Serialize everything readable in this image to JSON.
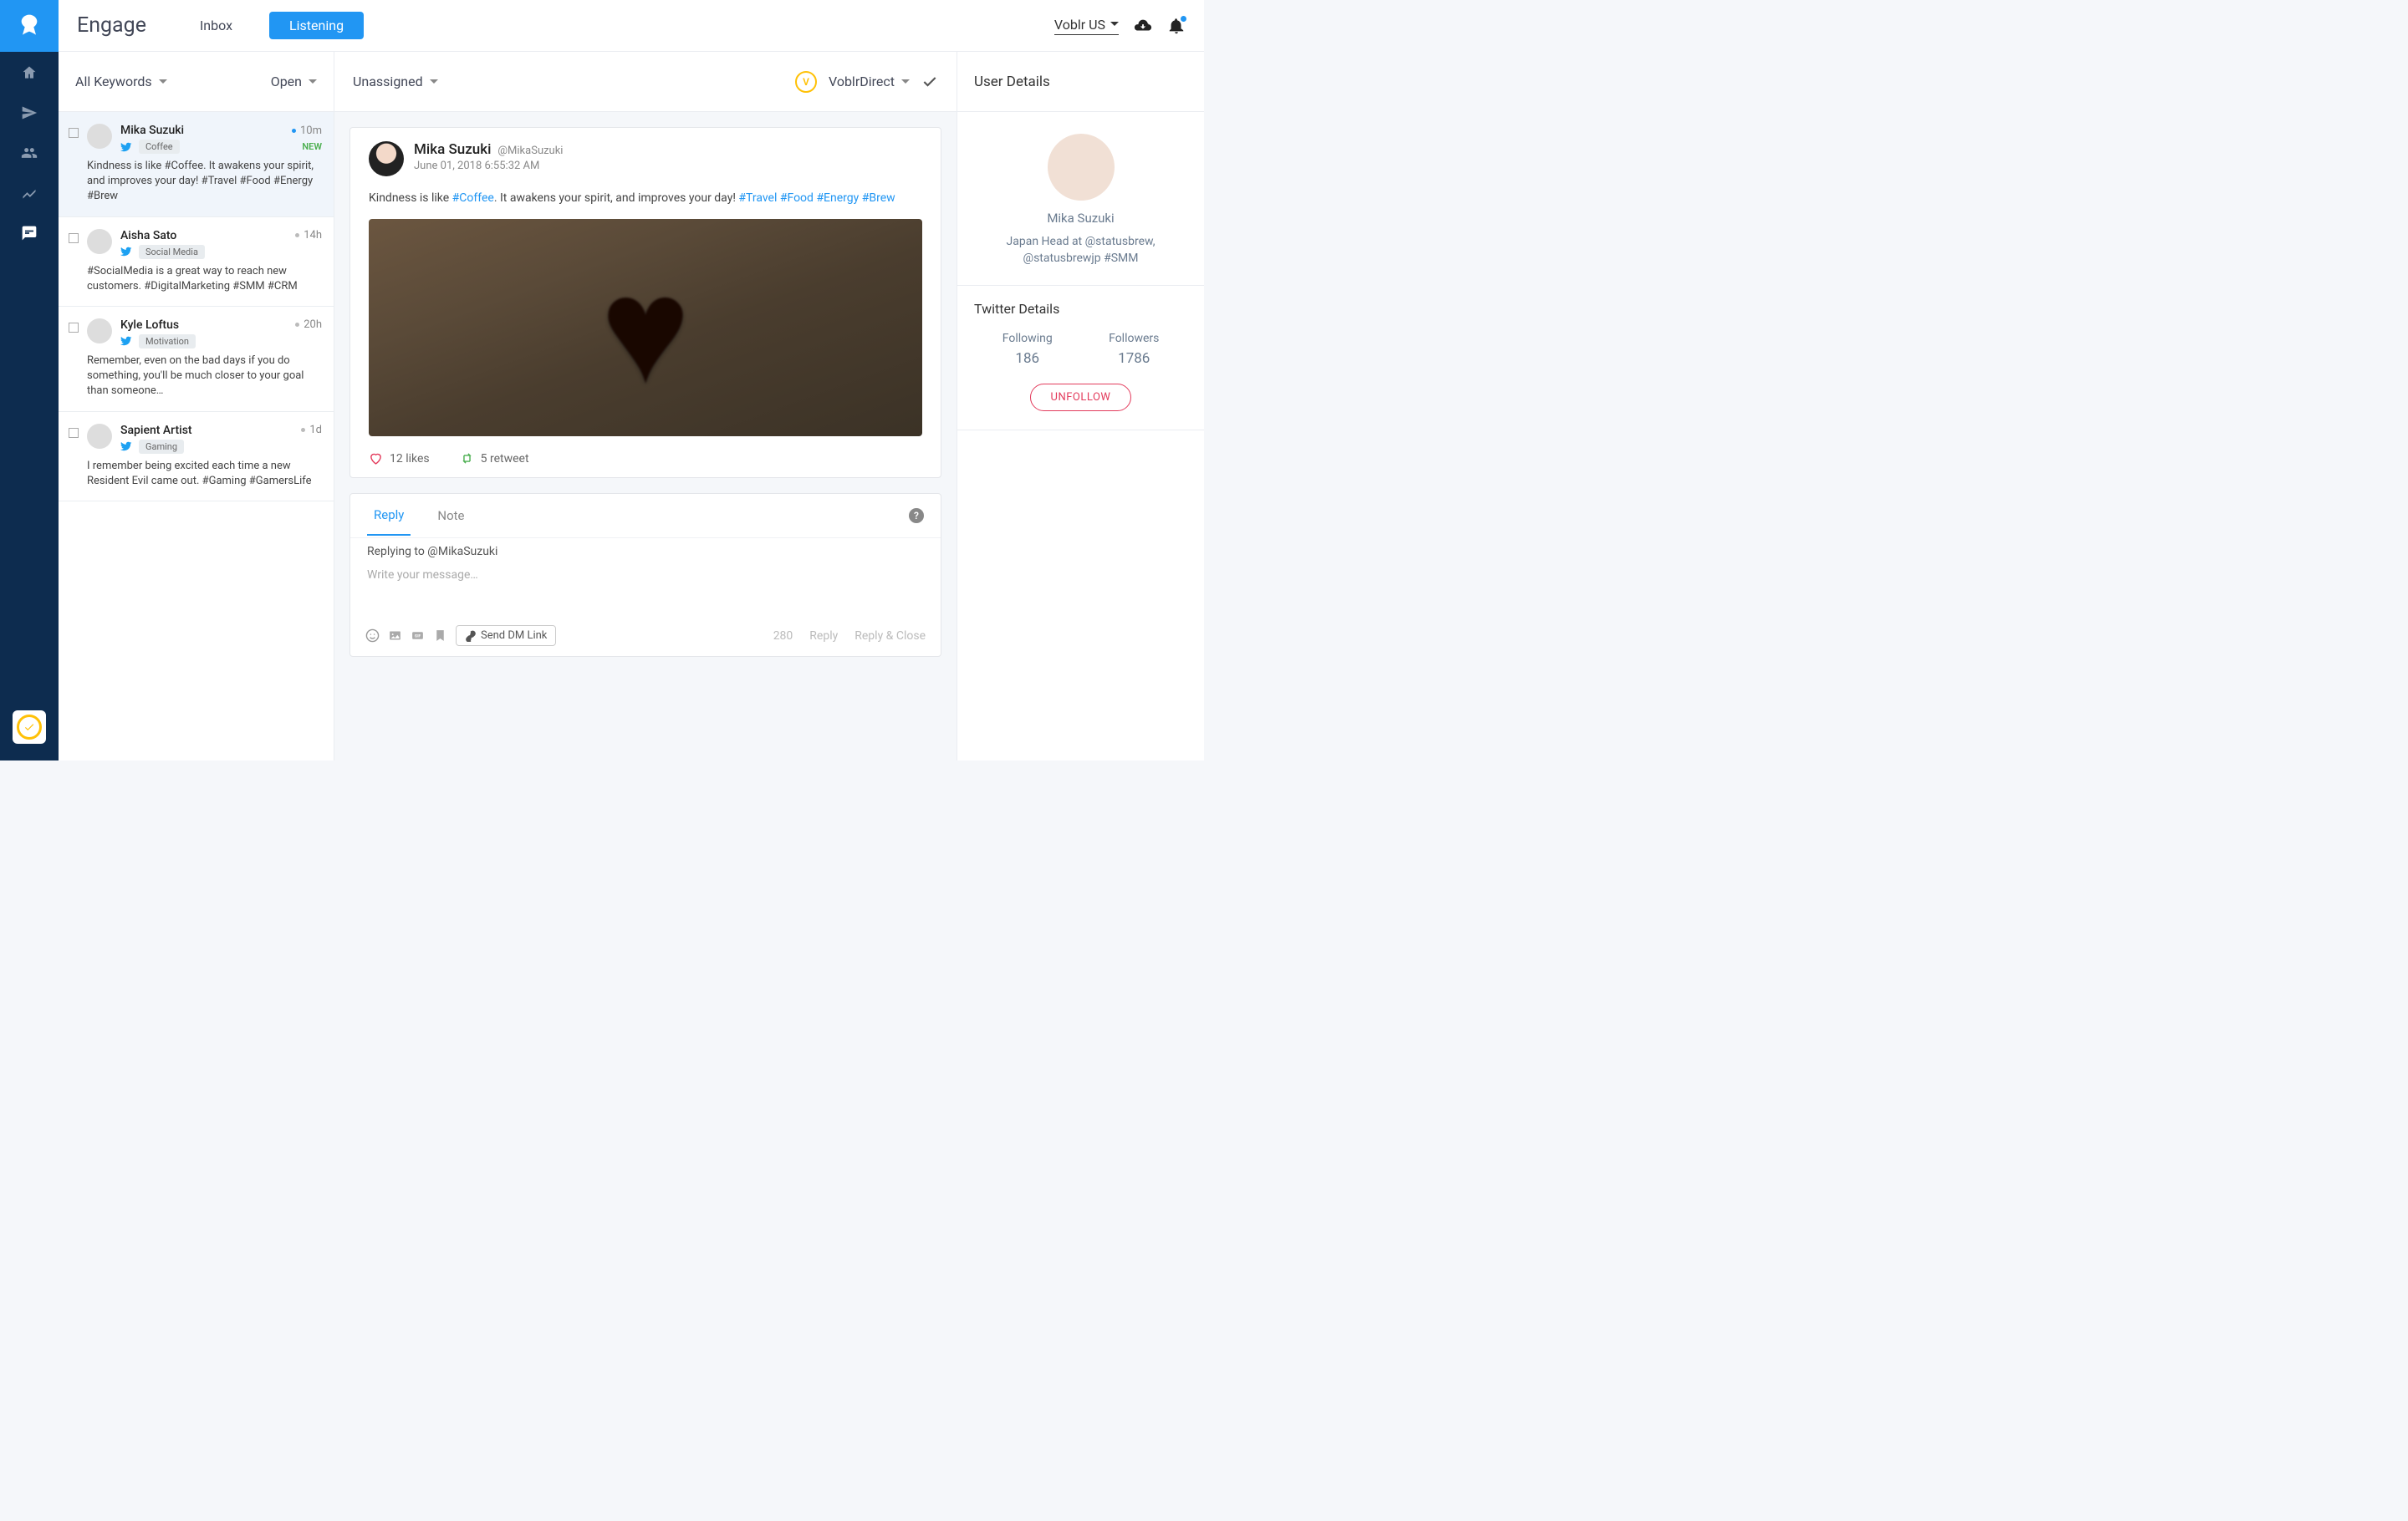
{
  "header": {
    "title": "Engage",
    "tabs": {
      "inbox": "Inbox",
      "listening": "Listening"
    },
    "account": "Voblr US"
  },
  "filters": {
    "keywords_label": "All Keywords",
    "status_label": "Open"
  },
  "list": [
    {
      "name": "Mika Suzuki",
      "tag": "Coffee",
      "time": "10m",
      "new": "NEW",
      "text": "Kindness is like #Coffee. It awakens your spirit, and improves your day! #Travel #Food #Energy #Brew",
      "selected": true,
      "dot": "blue"
    },
    {
      "name": "Aisha Sato",
      "tag": "Social Media",
      "time": "14h",
      "text": "#SocialMedia is a great way to reach new customers. #DigitalMarketing #SMM #CRM",
      "dot": "grey"
    },
    {
      "name": "Kyle Loftus",
      "tag": "Motivation",
      "time": "20h",
      "text": "Remember, even on the bad days if you do something, you'll be much closer to your goal than someone…",
      "dot": "grey"
    },
    {
      "name": "Sapient Artist",
      "tag": "Gaming",
      "time": "1d",
      "text": "I remember being excited each time a new Resident Evil came out. #Gaming #GamersLife",
      "dot": "grey"
    }
  ],
  "toolbar": {
    "assignment": "Unassigned",
    "channel": "VoblrDirect"
  },
  "post": {
    "author_name": "Mika Suzuki",
    "author_handle": "@MikaSuzuki",
    "date": "June 01, 2018 6:55:32 AM",
    "text_pre": "Kindness is like ",
    "hashtag_coffee": "#Coffee",
    "text_mid": ". It awakens your spirit, and improves your day! ",
    "hashtag_travel": "#Travel",
    "hashtag_food": "#Food",
    "hashtag_energy": "#Energy",
    "hashtag_brew": "#Brew",
    "likes": "12 likes",
    "retweets": "5 retweet"
  },
  "reply": {
    "tab_reply": "Reply",
    "tab_note": "Note",
    "replying_to": "Replying to @MikaSuzuki",
    "placeholder": "Write your message…",
    "send_dm": "Send DM Link",
    "char_count": "280",
    "btn_reply": "Reply",
    "btn_reply_close": "Reply & Close"
  },
  "user_details": {
    "title": "User Details",
    "name": "Mika Suzuki",
    "bio": "Japan Head at @statusbrew, @statusbrewjp #SMM",
    "twitter_title": "Twitter Details",
    "following_label": "Following",
    "following_value": "186",
    "followers_label": "Followers",
    "followers_value": "1786",
    "unfollow": "UNFOLLOW"
  }
}
